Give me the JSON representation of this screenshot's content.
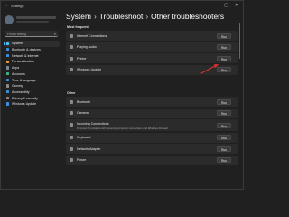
{
  "window": {
    "title": "Settings",
    "back_icon": "back-arrow-icon",
    "controls": [
      "minimize-icon",
      "maximize-icon",
      "close-icon"
    ]
  },
  "search": {
    "placeholder": "Find a setting"
  },
  "sidebar": {
    "items": [
      {
        "label": "System",
        "icon": "system-icon",
        "color": "#4cc2ff",
        "active": true
      },
      {
        "label": "Bluetooth & devices",
        "icon": "bluetooth-icon",
        "color": "#3a8fdf"
      },
      {
        "label": "Network & internet",
        "icon": "network-icon",
        "color": "#3a8fdf"
      },
      {
        "label": "Personalization",
        "icon": "personalization-icon",
        "color": "#e89a3c"
      },
      {
        "label": "Apps",
        "icon": "apps-icon",
        "color": "#7a8b99"
      },
      {
        "label": "Accounts",
        "icon": "accounts-icon",
        "color": "#3fb37a"
      },
      {
        "label": "Time & language",
        "icon": "time-language-icon",
        "color": "#3a8fdf"
      },
      {
        "label": "Gaming",
        "icon": "gaming-icon",
        "color": "#8a8a8a"
      },
      {
        "label": "Accessibility",
        "icon": "accessibility-icon",
        "color": "#3a8fdf"
      },
      {
        "label": "Privacy & security",
        "icon": "shield-icon",
        "color": "#8a8a8a"
      },
      {
        "label": "Windows Update",
        "icon": "windows-update-icon",
        "color": "#3a8fdf"
      }
    ]
  },
  "breadcrumb": {
    "items": [
      "System",
      "Troubleshoot",
      "Other troubleshooters"
    ],
    "separator": "›"
  },
  "sections": {
    "most_frequent": {
      "label": "Most frequent",
      "rows": [
        {
          "label": "Internet Connections",
          "icon": "wifi-icon",
          "color": "#8a8a8a",
          "button": "Run"
        },
        {
          "label": "Playing Audio",
          "icon": "speaker-icon",
          "color": "#8a8a8a",
          "button": "Run"
        },
        {
          "label": "Printer",
          "icon": "printer-icon",
          "color": "#8a8a8a",
          "button": "Run"
        },
        {
          "label": "Windows Update",
          "icon": "windows-update-icon",
          "color": "#8a8a8a",
          "button": "Run"
        }
      ]
    },
    "other": {
      "label": "Other",
      "rows": [
        {
          "label": "Bluetooth",
          "icon": "bluetooth-icon",
          "color": "#8a8a8a",
          "button": "Run"
        },
        {
          "label": "Camera",
          "icon": "camera-icon",
          "color": "#8a8a8a",
          "button": "Run"
        },
        {
          "label": "Incoming Connections",
          "description": "Find and fix problems with incoming computer connections and Windows Firewall.",
          "icon": "incoming-connections-icon",
          "color": "#8a8a8a",
          "button": "Run"
        },
        {
          "label": "Keyboard",
          "icon": "keyboard-icon",
          "color": "#8a8a8a",
          "button": "Run"
        },
        {
          "label": "Network Adapter",
          "icon": "network-adapter-icon",
          "color": "#8a8a8a",
          "button": "Run"
        },
        {
          "label": "Power",
          "icon": "power-icon",
          "color": "#8a8a8a",
          "button": "Run"
        }
      ]
    }
  },
  "annotation": {
    "color": "#d9302c",
    "icon": "red-arrow-annotation-icon"
  }
}
